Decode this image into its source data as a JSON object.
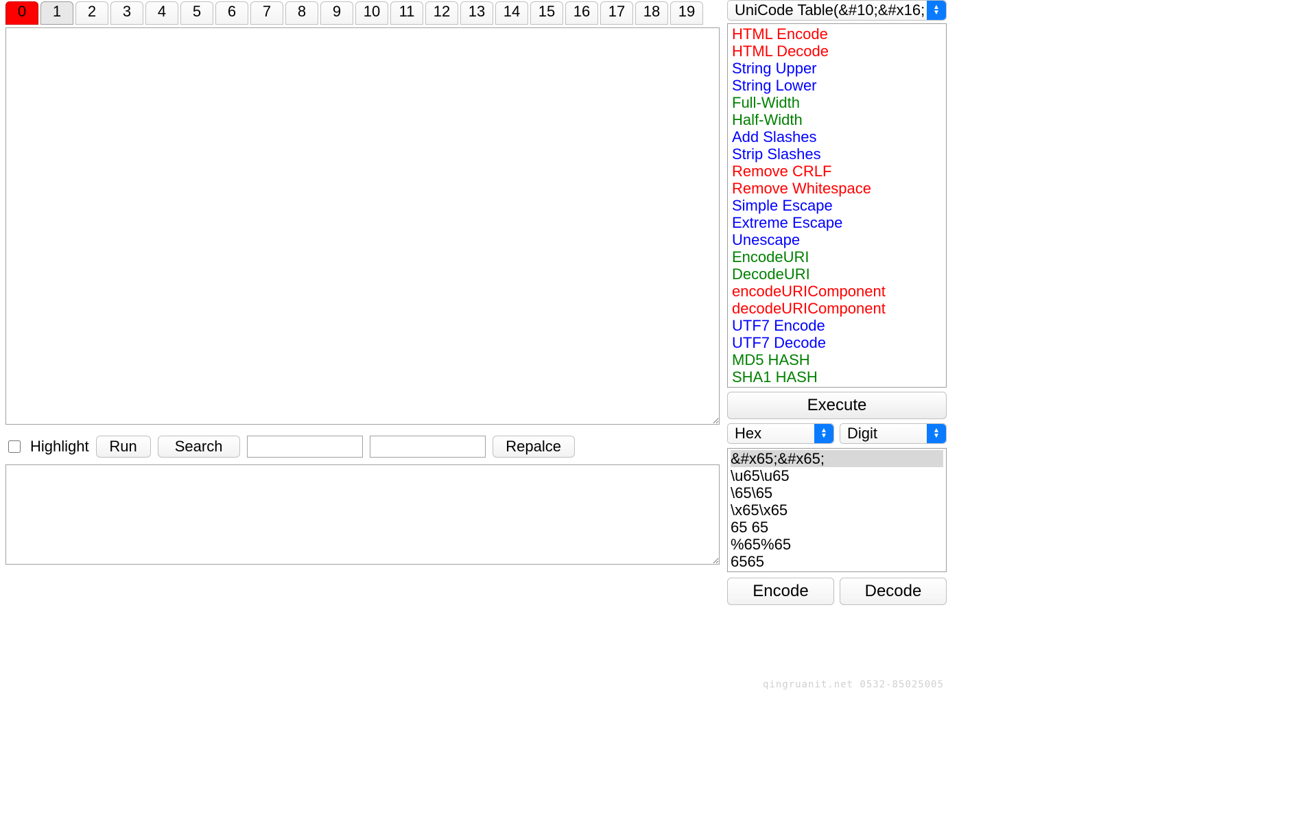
{
  "tabs": {
    "labels": [
      "0",
      "1",
      "2",
      "3",
      "4",
      "5",
      "6",
      "7",
      "8",
      "9",
      "10",
      "11",
      "12",
      "13",
      "14",
      "15",
      "16",
      "17",
      "18",
      "19"
    ],
    "active_index": 0,
    "selected_index": 1
  },
  "main_textarea": {
    "value": ""
  },
  "toolbar": {
    "highlight_label": "Highlight",
    "highlight_checked": false,
    "run_label": "Run",
    "search_label": "Search",
    "search_value": "",
    "replace_value": "",
    "replace_label": "Repalce"
  },
  "bottom_textarea": {
    "value": ""
  },
  "right": {
    "top_select_label": "UniCode Table(&#10;&#x16;",
    "operations": [
      {
        "label": "HTML Encode",
        "color": "red"
      },
      {
        "label": "HTML Decode",
        "color": "red"
      },
      {
        "label": "String Upper",
        "color": "blue"
      },
      {
        "label": "String Lower",
        "color": "blue"
      },
      {
        "label": "Full-Width",
        "color": "green"
      },
      {
        "label": "Half-Width",
        "color": "green"
      },
      {
        "label": "Add Slashes",
        "color": "blue"
      },
      {
        "label": "Strip Slashes",
        "color": "blue"
      },
      {
        "label": "Remove CRLF",
        "color": "red"
      },
      {
        "label": "Remove Whitespace",
        "color": "red"
      },
      {
        "label": "Simple Escape",
        "color": "blue"
      },
      {
        "label": "Extreme Escape",
        "color": "blue"
      },
      {
        "label": "Unescape",
        "color": "blue"
      },
      {
        "label": "EncodeURI",
        "color": "green"
      },
      {
        "label": "DecodeURI",
        "color": "green"
      },
      {
        "label": "encodeURIComponent",
        "color": "red"
      },
      {
        "label": "decodeURIComponent",
        "color": "red"
      },
      {
        "label": "UTF7 Encode",
        "color": "blue"
      },
      {
        "label": "UTF7 Decode",
        "color": "blue"
      },
      {
        "label": "MD5 HASH",
        "color": "green"
      },
      {
        "label": "SHA1 HASH",
        "color": "green"
      }
    ],
    "execute_label": "Execute",
    "mode_left": "Hex",
    "mode_right": "Digit",
    "preview_lines": [
      "&#x65;&#x65;",
      "\\u65\\u65",
      "\\65\\65",
      "\\x65\\x65",
      "65 65",
      "%65%65",
      "6565"
    ],
    "preview_selected_index": 0,
    "encode_label": "Encode",
    "decode_label": "Decode"
  },
  "watermark": "qingruanit.net 0532-85025005"
}
